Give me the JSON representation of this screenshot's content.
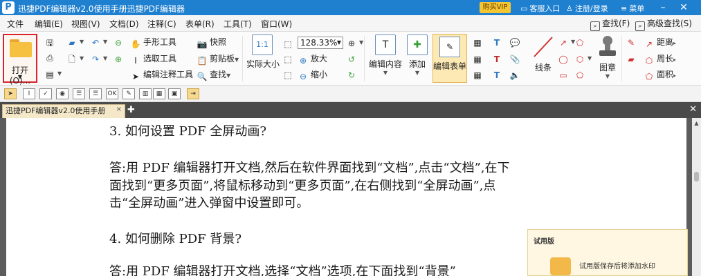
{
  "titlebar": {
    "app_title": "迅捷PDF编辑器v2.0使用手册迅捷PDF编辑器",
    "buy_vip": "购买VIP",
    "customer_service": "客服入口",
    "register_login": "注册/登录",
    "menu": "菜单"
  },
  "menubar": {
    "items": [
      "文件",
      "编辑(E)",
      "视图(V)",
      "文档(D)",
      "注释(C)",
      "表单(R)",
      "工具(T)",
      "窗口(W)"
    ],
    "find": "查找(F)",
    "advanced_find": "高级查找(S)"
  },
  "ribbon": {
    "open": "打开(O)...",
    "hand_tool": "手形工具",
    "select_tool": "选取工具",
    "edit_annot_tool": "编辑注释工具",
    "snapshot": "快照",
    "clipboard": "剪贴板",
    "find": "查找",
    "actual_size": "实际大小",
    "zoom_value": "128.33%",
    "zoom_in": "放大",
    "zoom_out": "缩小",
    "edit_content": "编辑内容",
    "add": "添加",
    "edit_form": "编辑表单",
    "line": "线条",
    "stamp": "图章",
    "distance": "距离",
    "perimeter": "周长",
    "area": "面积"
  },
  "quickbar": {
    "ok_label": "OK"
  },
  "tabs": {
    "doc_tab": "迅捷PDF编辑器v2.0使用手册"
  },
  "document": {
    "q3_heading": "3. 如何设置 PDF 全屏动画?",
    "a3_line1": "答:用 PDF 编辑器打开文档,然后在软件界面找到“文档”,点击“文档”,在下",
    "a3_line2": "面找到“更多页面”,将鼠标移动到“更多页面”,在右侧找到“全屏动画”,点",
    "a3_line3": "击“全屏动画”进入弹窗中设置即可。",
    "q4_heading": "4. 如何删除 PDF 背景?",
    "a4_line1": "答:用 PDF 编辑器打开文档,选择“文档”选项,在下面找到“背景”"
  },
  "trial": {
    "title": "试用版",
    "text": "试用版保存后将添加水印"
  },
  "colors": {
    "titlebar": "#1f80d0",
    "vip": "#f3c533",
    "open_border": "#d9232d",
    "active_tool": "#fde9b3"
  }
}
